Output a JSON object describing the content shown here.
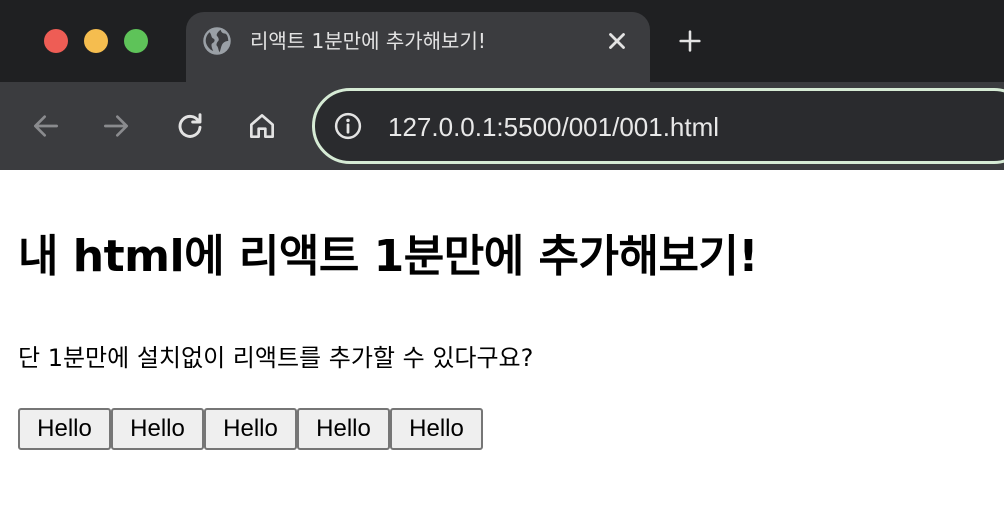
{
  "browser": {
    "tab": {
      "title": "리액트 1분만에 추가해보기!",
      "favicon_icon": "globe-icon",
      "close_icon": "close-icon"
    },
    "new_tab_icon": "plus-icon",
    "toolbar": {
      "back_icon": "arrow-left-icon",
      "forward_icon": "arrow-right-icon",
      "reload_icon": "reload-icon",
      "home_icon": "home-icon",
      "site_info_icon": "info-icon"
    },
    "address": {
      "url": "127.0.0.1:5500/001/001.html"
    },
    "window_controls": [
      "close",
      "minimize",
      "zoom"
    ],
    "colors": {
      "close": "#ee5d55",
      "minimize": "#f5bd4f",
      "zoom": "#5ec359",
      "omnibox_focus_ring": "#d6ebd5"
    }
  },
  "page": {
    "heading": "내 html에 리액트 1분만에 추가해보기!",
    "description": "단 1분만에 설치없이 리액트를 추가할 수 있다구요?",
    "buttons": [
      {
        "label": "Hello"
      },
      {
        "label": "Hello"
      },
      {
        "label": "Hello"
      },
      {
        "label": "Hello"
      },
      {
        "label": "Hello"
      }
    ]
  }
}
